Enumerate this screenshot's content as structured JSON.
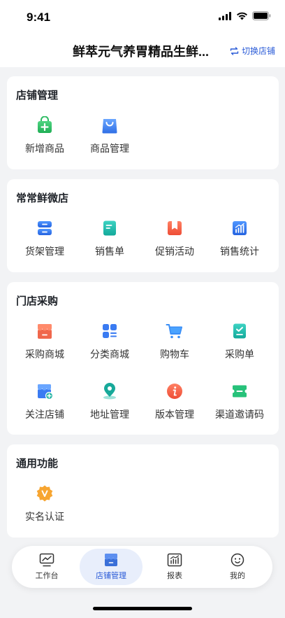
{
  "status": {
    "time": "9:41"
  },
  "nav": {
    "title": "鲜萃元气养胃精品生鲜...",
    "switch_label": "切换店铺"
  },
  "sections": {
    "store_mgmt": {
      "title": "店铺管理",
      "items": [
        {
          "label": "新增商品",
          "icon": "add-product-icon"
        },
        {
          "label": "商品管理",
          "icon": "shopping-bag-icon"
        }
      ]
    },
    "micro_store": {
      "title": "常常鲜微店",
      "items": [
        {
          "label": "货架管理",
          "icon": "shelf-icon"
        },
        {
          "label": "销售单",
          "icon": "sales-order-icon"
        },
        {
          "label": "促销活动",
          "icon": "promotion-icon"
        },
        {
          "label": "销售统计",
          "icon": "statistics-icon"
        }
      ]
    },
    "purchase": {
      "title": "门店采购",
      "items": [
        {
          "label": "采购商城",
          "icon": "store-awning-icon"
        },
        {
          "label": "分类商城",
          "icon": "category-icon"
        },
        {
          "label": "购物车",
          "icon": "cart-icon"
        },
        {
          "label": "采购单",
          "icon": "checklist-icon"
        },
        {
          "label": "关注店铺",
          "icon": "follow-store-icon"
        },
        {
          "label": "地址管理",
          "icon": "location-pin-icon"
        },
        {
          "label": "版本管理",
          "icon": "info-icon"
        },
        {
          "label": "渠道邀请码",
          "icon": "ticket-icon"
        }
      ]
    },
    "general": {
      "title": "通用功能",
      "items": [
        {
          "label": "实名认证",
          "icon": "verified-badge-icon"
        }
      ]
    }
  },
  "tabbar": {
    "tabs": [
      {
        "label": "工作台",
        "icon": "dashboard-icon"
      },
      {
        "label": "店铺管理",
        "icon": "store-icon",
        "active": true
      },
      {
        "label": "报表",
        "icon": "report-icon"
      },
      {
        "label": "我的",
        "icon": "profile-icon"
      }
    ]
  },
  "colors": {
    "accent": "#2a5bd7",
    "background": "#f2f3f5",
    "card": "#ffffff"
  }
}
